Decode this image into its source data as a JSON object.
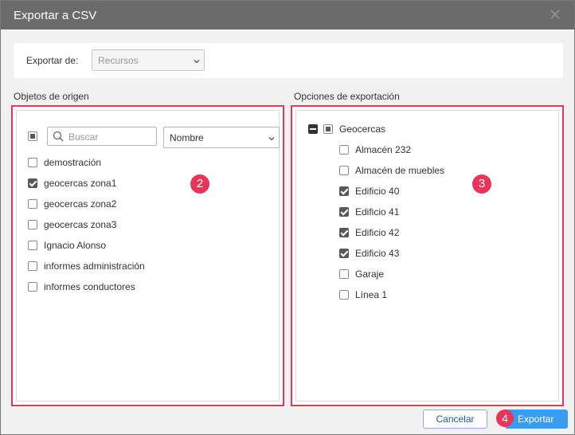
{
  "window": {
    "title": "Exportar a CSV"
  },
  "export_from": {
    "label": "Exportar de:",
    "value": "Recursos"
  },
  "source": {
    "section_title": "Objetos de origen",
    "search_placeholder": "Buscar",
    "sort_value": "Nombre",
    "badge": "2",
    "items": [
      {
        "label": "demostración",
        "checked": false
      },
      {
        "label": "geocercas zona1",
        "checked": true
      },
      {
        "label": "geocercas zona2",
        "checked": false
      },
      {
        "label": "geocercas zona3",
        "checked": false
      },
      {
        "label": "Ignacio Alonso",
        "checked": false
      },
      {
        "label": "informes administración",
        "checked": false
      },
      {
        "label": "informes conductores",
        "checked": false
      }
    ]
  },
  "options": {
    "section_title": "Opciones de exportación",
    "badge": "3",
    "group": {
      "label": "Geocercas"
    },
    "items": [
      {
        "label": "Almacén 232",
        "checked": false
      },
      {
        "label": "Almacén de muebles",
        "checked": false
      },
      {
        "label": "Edificio 40",
        "checked": true
      },
      {
        "label": "Edificio 41",
        "checked": true
      },
      {
        "label": "Edificio 42",
        "checked": true
      },
      {
        "label": "Edificio 43",
        "checked": true
      },
      {
        "label": "Garaje",
        "checked": false
      },
      {
        "label": "Línea 1",
        "checked": false
      }
    ]
  },
  "footer": {
    "cancel_label": "Cancelar",
    "export_label": "Exportar",
    "badge": "4"
  },
  "colors": {
    "accent": "#e8355a",
    "primary_button": "#3a9cf0",
    "titlebar": "#6b6b6b"
  }
}
